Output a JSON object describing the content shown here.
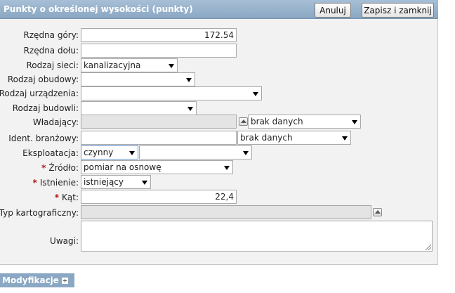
{
  "header": {
    "title": "Punkty o określonej wysokości (punkty)",
    "cancel_label": "Anuluj",
    "save_close_label": "Zapisz i zamknij"
  },
  "form": {
    "rzedna_gory": {
      "label": "Rzędna góry:",
      "value": "172.54"
    },
    "rzedna_dolu": {
      "label": "Rzędna dołu:",
      "value": ""
    },
    "rodzaj_sieci": {
      "label": "Rodzaj sieci:",
      "value": "kanalizacyjna"
    },
    "rodzaj_obudowy": {
      "label": "Rodzaj obudowy:",
      "value": ""
    },
    "rodzaj_urzadzenia": {
      "label": "Rodzaj urządzenia:",
      "value": ""
    },
    "rodzaj_budowli": {
      "label": "Rodzaj budowli:",
      "value": ""
    },
    "wladajacy": {
      "label": "Władający:",
      "value": "",
      "select_value": "brak danych"
    },
    "ident_branzowy": {
      "label": "Ident. branżowy:",
      "value": "",
      "select_value": "brak danych"
    },
    "eksploatacja": {
      "label": "Eksploatacja:",
      "value": "czynny",
      "second_value": ""
    },
    "zrodlo": {
      "label": "Źródło:",
      "value": "pomiar na osnowę"
    },
    "istnienie": {
      "label": "Istnienie:",
      "value": "istniejący"
    },
    "kat": {
      "label": "Kąt:",
      "value": "22,4"
    },
    "typ_kartograficzny": {
      "label": "Typ kartograficzny:",
      "value": ""
    },
    "uwagi": {
      "label": "Uwagi:",
      "value": ""
    }
  },
  "required_marker": "*",
  "modifications": {
    "label": "Modyfikacje"
  },
  "colors": {
    "header_bg": "#8aa7c3",
    "form_bg": "#f2f2f2",
    "required": "#b01818"
  }
}
